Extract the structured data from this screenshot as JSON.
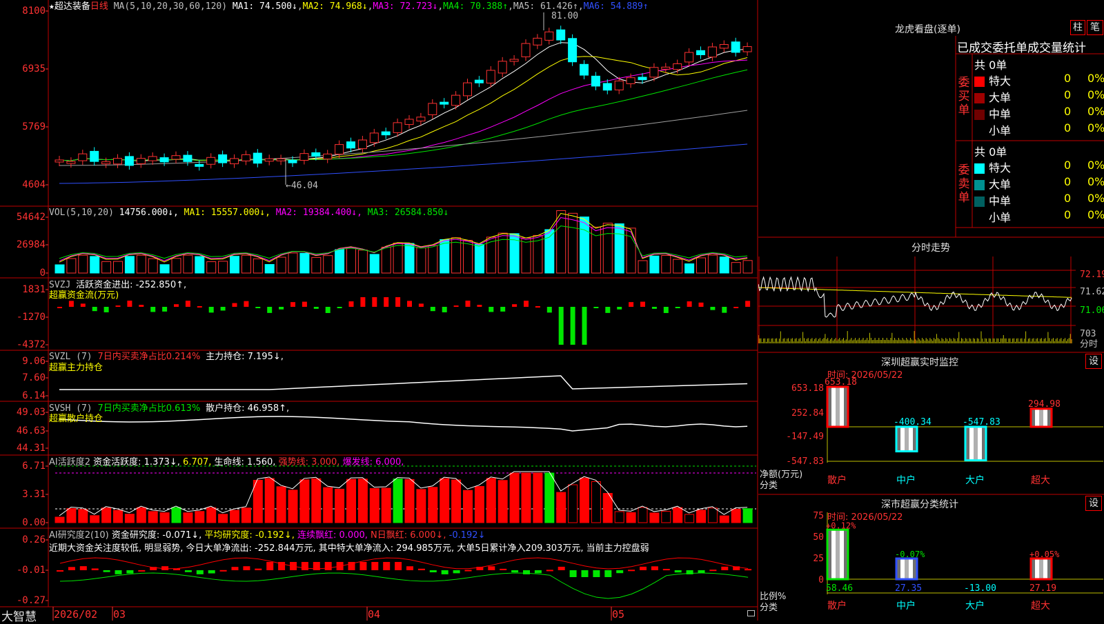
{
  "main_chart": {
    "title_star": "★",
    "stock_name": "超达装备",
    "period_label": "日线",
    "ma_params": "MA(5,10,20,30,60,120)",
    "ma1": "MA1: 74.500↓",
    "ma2": "MA2: 74.968↓",
    "ma3": "MA3: 72.723↓",
    "ma4": "MA4: 70.388↑",
    "ma5": "MA5: 61.426↑",
    "ma6": "MA6: 54.889↑",
    "y_ticks": [
      "8100",
      "6935",
      "5769",
      "4604"
    ],
    "high_mark": "81.00",
    "low_mark": "←46.04",
    "colors": {
      "ma1": "#ffffff",
      "ma2": "#ffff00",
      "ma3": "#ff00ff",
      "ma4": "#00e600",
      "ma5": "#a0a0a0",
      "ma6": "#3050ff",
      "up": "#ff3232",
      "down": "#00ffff"
    }
  },
  "vol_panel": {
    "title": "VOL(5,10,20)",
    "value": "14756.000↓,",
    "ma1": "MA1: 15557.000↓,",
    "ma2": "MA2: 19384.400↓,",
    "ma3": "MA3: 26584.850↓",
    "y_ticks": [
      "54642",
      "26984",
      "0"
    ]
  },
  "svzj_panel": {
    "title": "SVZJ",
    "field": "活跃资金进出: -252.850↑,",
    "subtitle": "超赢资金流(万元)",
    "y_ticks": [
      "1831",
      "-1270",
      "-4372"
    ]
  },
  "svzl_panel": {
    "title": "SVZL (7)",
    "field1": "7日内买卖净占比0.214%",
    "field2": "主力持仓: 7.195↓,",
    "subtitle": "超赢主力持仓",
    "y_ticks": [
      "9.06",
      "7.60",
      "6.14"
    ]
  },
  "svsh_panel": {
    "title": "SVSH (7)",
    "field1": "7日内买卖净占比0.613%",
    "field2": "散户持仓: 46.958↑,",
    "subtitle": "超赢散户持仓",
    "y_ticks": [
      "49.03",
      "46.63",
      "44.31"
    ]
  },
  "ai_active_panel": {
    "title": "AI活跃度2",
    "f1": "资金活跃度: 1.373↓,",
    "f2": "6.707,",
    "f3": "生命线: 1.560,",
    "f4": "强势线: 3.000,",
    "f5": "爆发线: 6.000,",
    "y_ticks": [
      "6.71",
      "3.31",
      "0.00"
    ]
  },
  "ai_research_panel": {
    "title": "AI研究度2(10)",
    "f1": "资金研究度: -0.071↓,",
    "f2": "平均研究度: -0.192↓,",
    "f3": "连续飘红: 0.000,",
    "f4": "N日飘红: 6.000↓,",
    "f5": "-0.192↓",
    "comment": "近期大资金关注度较低, 明显弱势, 今日大单净流出: -252.844万元, 其中特大单净流入: 294.985万元, 大单5日累计净入209.303万元, 当前主力控盘弱",
    "y_ticks": [
      "0.26",
      "-0.01",
      "-0.27"
    ]
  },
  "x_axis": {
    "brand": "大智慧",
    "labels": [
      "2026/02",
      "03",
      "04",
      "05"
    ]
  },
  "dragon_tiger": {
    "title": "龙虎看盘(逐单)",
    "btn_bar": "柱",
    "btn_pen": "笔",
    "header": "已成交委托单成交量统计",
    "buy_label": "委买单",
    "sell_label": "委卖单",
    "buy_total": "共 0单",
    "sell_total": "共 0单",
    "buy_rows": [
      {
        "name": "特大",
        "count": "0",
        "pct": "0%",
        "color": "#ff0000"
      },
      {
        "name": "大单",
        "count": "0",
        "pct": "0%",
        "color": "#a00000"
      },
      {
        "name": "中单",
        "count": "0",
        "pct": "0%",
        "color": "#700000"
      },
      {
        "name": "小单",
        "count": "0",
        "pct": "0%",
        "color": "#000000"
      }
    ],
    "sell_rows": [
      {
        "name": "特大",
        "count": "0",
        "pct": "0%",
        "color": "#00ffff"
      },
      {
        "name": "大单",
        "count": "0",
        "pct": "0%",
        "color": "#009090"
      },
      {
        "name": "中单",
        "count": "0",
        "pct": "0%",
        "color": "#006060"
      },
      {
        "name": "小单",
        "count": "0",
        "pct": "0%",
        "color": "#000000"
      }
    ]
  },
  "intraday": {
    "title": "分时走势",
    "price_ticks": [
      "72.19",
      "71.62",
      "71.06"
    ],
    "vol_tick": "703",
    "vol_label": "分时"
  },
  "sz_monitor": {
    "title": "深圳超赢实时监控",
    "btn": "设",
    "time": "时间: 2026/05/22",
    "y_ticks": [
      "653.18",
      "252.84",
      "-147.49",
      "-547.83"
    ],
    "y_title_1": "净额(万元)",
    "y_title_2": "分类",
    "categories": [
      "散户",
      "中户",
      "大户",
      "超大"
    ],
    "values": [
      653.18,
      -400.34,
      -547.83,
      294.98
    ],
    "value_labels": [
      "653.18",
      "-400.34",
      "-547.83",
      "294.98"
    ]
  },
  "sz_classify": {
    "title": "深市超赢分类统计",
    "btn": "设",
    "time": "时间: 2026/05/22",
    "y_ticks": [
      "75",
      "50",
      "25",
      "0"
    ],
    "y_title_1": "比例%",
    "y_title_2": "分类",
    "categories": [
      "散户",
      "中户",
      "大户",
      "超大"
    ],
    "values": [
      58.46,
      27.35,
      -13.0,
      27.19
    ],
    "value_labels": [
      "58.46",
      "27.35",
      "-13.00",
      "27.19"
    ],
    "change_labels": [
      "+0.12%",
      "-0.07%",
      "",
      "+0.05%"
    ]
  }
}
